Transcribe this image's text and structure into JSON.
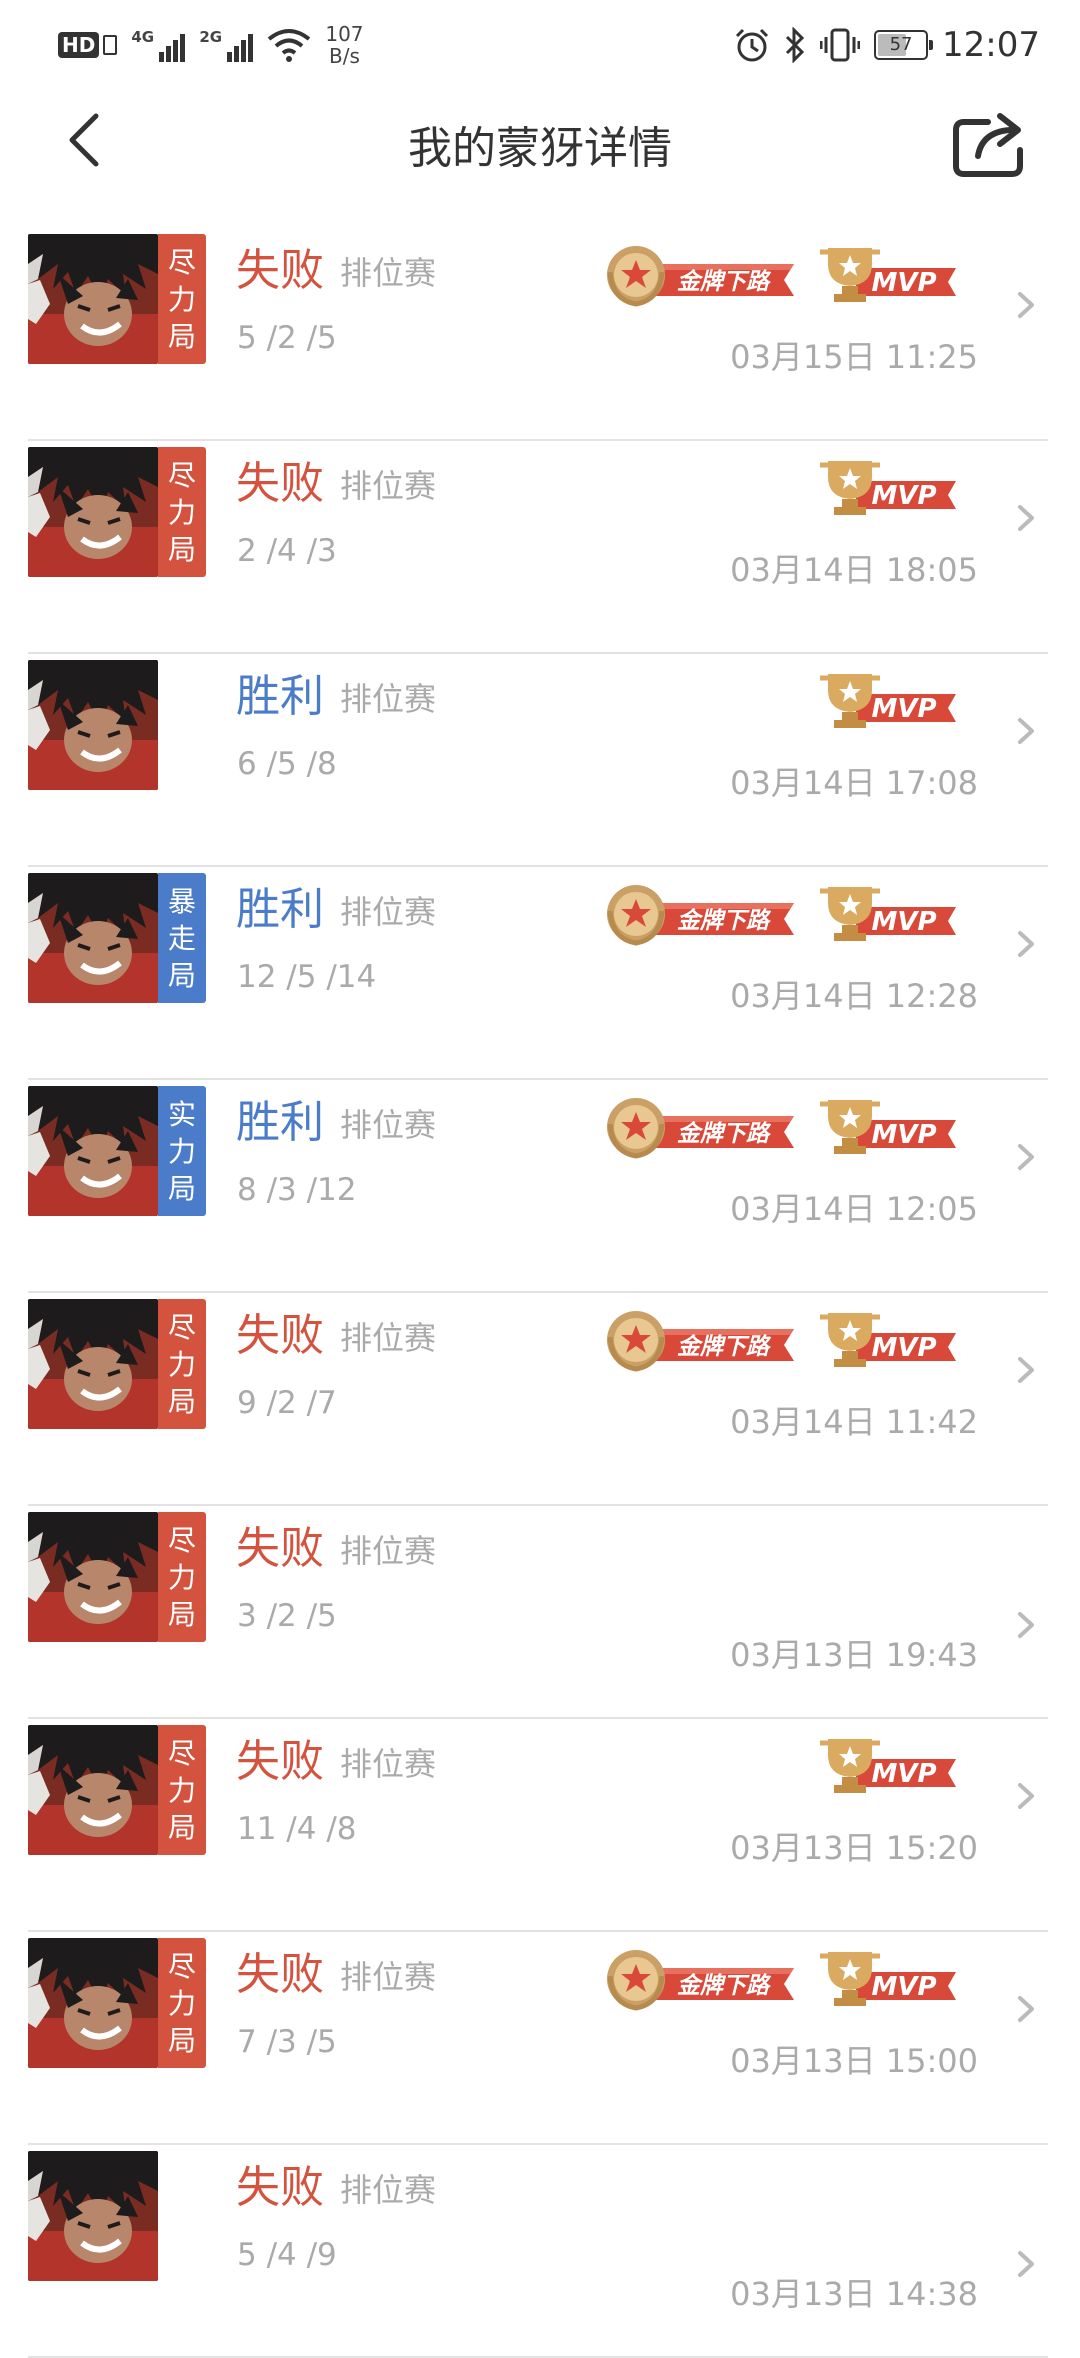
{
  "status_bar": {
    "hd": "HD",
    "sim1_gen": "4G",
    "sim2_gen": "2G",
    "speed_value": "107",
    "speed_unit": "B/s",
    "battery": "57",
    "time": "12:07"
  },
  "header": {
    "title": "我的蒙犽详情"
  },
  "colors": {
    "loss": "#d4533f",
    "win": "#4a7cc9",
    "tag_red": "#d4533f",
    "tag_blue": "#4a7cc9",
    "muted": "#aaaaaa"
  },
  "badge_labels": {
    "gold": "金牌下路",
    "mvp": "MVP"
  },
  "matches": [
    {
      "result": "失败",
      "mode": "排位赛",
      "kda": "5 /2 /5",
      "time": "03月15日 11:25",
      "tag": [
        "尽",
        "力",
        "局"
      ],
      "tag_color": "red",
      "gold": true,
      "mvp": true
    },
    {
      "result": "失败",
      "mode": "排位赛",
      "kda": "2 /4 /3",
      "time": "03月14日 18:05",
      "tag": [
        "尽",
        "力",
        "局"
      ],
      "tag_color": "red",
      "gold": false,
      "mvp": true
    },
    {
      "result": "胜利",
      "mode": "排位赛",
      "kda": "6 /5 /8",
      "time": "03月14日 17:08",
      "tag": null,
      "tag_color": null,
      "gold": false,
      "mvp": true
    },
    {
      "result": "胜利",
      "mode": "排位赛",
      "kda": "12 /5 /14",
      "time": "03月14日 12:28",
      "tag": [
        "暴",
        "走",
        "局"
      ],
      "tag_color": "blue",
      "gold": true,
      "mvp": true
    },
    {
      "result": "胜利",
      "mode": "排位赛",
      "kda": "8 /3 /12",
      "time": "03月14日 12:05",
      "tag": [
        "实",
        "力",
        "局"
      ],
      "tag_color": "blue",
      "gold": true,
      "mvp": true
    },
    {
      "result": "失败",
      "mode": "排位赛",
      "kda": "9 /2 /7",
      "time": "03月14日 11:42",
      "tag": [
        "尽",
        "力",
        "局"
      ],
      "tag_color": "red",
      "gold": true,
      "mvp": true
    },
    {
      "result": "失败",
      "mode": "排位赛",
      "kda": "3 /2 /5",
      "time": "03月13日 19:43",
      "tag": [
        "尽",
        "力",
        "局"
      ],
      "tag_color": "red",
      "gold": false,
      "mvp": false
    },
    {
      "result": "失败",
      "mode": "排位赛",
      "kda": "11 /4 /8",
      "time": "03月13日 15:20",
      "tag": [
        "尽",
        "力",
        "局"
      ],
      "tag_color": "red",
      "gold": false,
      "mvp": true
    },
    {
      "result": "失败",
      "mode": "排位赛",
      "kda": "7 /3 /5",
      "time": "03月13日 15:00",
      "tag": [
        "尽",
        "力",
        "局"
      ],
      "tag_color": "red",
      "gold": true,
      "mvp": true
    },
    {
      "result": "失败",
      "mode": "排位赛",
      "kda": "5 /4 /9",
      "time": "03月13日 14:38",
      "tag": null,
      "tag_color": null,
      "gold": false,
      "mvp": false
    }
  ]
}
